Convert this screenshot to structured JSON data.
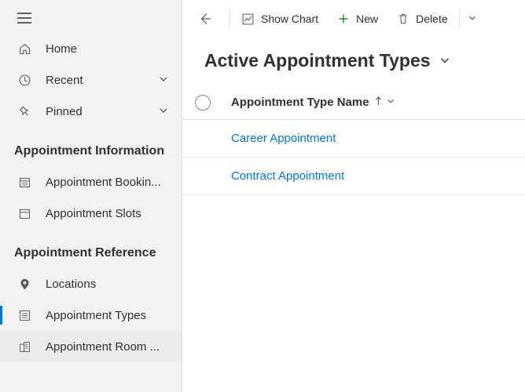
{
  "sidebar": {
    "nav_home": "Home",
    "nav_recent": "Recent",
    "nav_pinned": "Pinned",
    "section_info": "Appointment Information",
    "nav_booking": "Appointment Bookin...",
    "nav_slots": "Appointment Slots",
    "section_ref": "Appointment Reference",
    "nav_locations": "Locations",
    "nav_types": "Appointment Types",
    "nav_rooms": "Appointment Room ..."
  },
  "cmdbar": {
    "show_chart": "Show Chart",
    "new": "New",
    "delete": "Delete"
  },
  "view": {
    "title": "Active Appointment Types"
  },
  "grid": {
    "column_name": "Appointment Type Name",
    "rows": [
      {
        "name": "Career Appointment"
      },
      {
        "name": "Contract Appointment"
      }
    ]
  }
}
